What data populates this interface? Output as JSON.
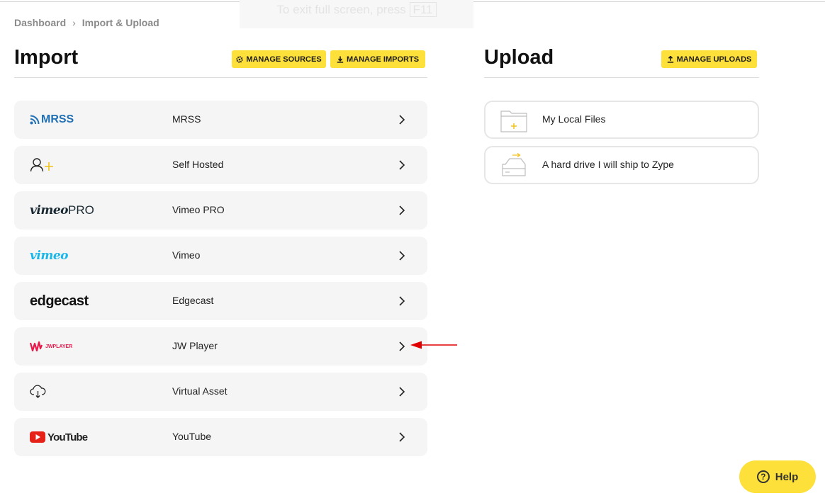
{
  "banner": {
    "text": "To exit full screen, press",
    "key": "F11"
  },
  "breadcrumb": {
    "items": [
      "Dashboard",
      "Import & Upload"
    ],
    "separator": "›"
  },
  "import_section": {
    "title": "Import",
    "buttons": {
      "manage_sources": "MANAGE SOURCES",
      "manage_imports": "MANAGE IMPORTS"
    },
    "rows": [
      {
        "label": "MRSS",
        "logo_text": "MRSS",
        "icon": "rss-icon"
      },
      {
        "label": "Self Hosted",
        "icon": "user-plus-icon"
      },
      {
        "label": "Vimeo PRO",
        "logo_text": "vimeo",
        "logo_suffix": "PRO"
      },
      {
        "label": "Vimeo",
        "logo_text": "vimeo"
      },
      {
        "label": "Edgecast",
        "logo_text": "edgecast"
      },
      {
        "label": "JW Player",
        "logo_text": "JWPLAYER"
      },
      {
        "label": "Virtual Asset",
        "icon": "cloud-download-icon"
      },
      {
        "label": "YouTube",
        "logo_text": "YouTube"
      }
    ]
  },
  "upload_section": {
    "title": "Upload",
    "buttons": {
      "manage_uploads": "MANAGE UPLOADS"
    },
    "rows": [
      {
        "label": "My Local Files",
        "icon": "folder-plus-icon"
      },
      {
        "label": "A hard drive I will ship to Zype",
        "icon": "hard-drive-icon"
      }
    ]
  },
  "help": {
    "label": "Help"
  },
  "colors": {
    "accent_yellow": "#fde03a",
    "annotation_red": "#e00000",
    "row_bg": "#f5f5f5"
  }
}
